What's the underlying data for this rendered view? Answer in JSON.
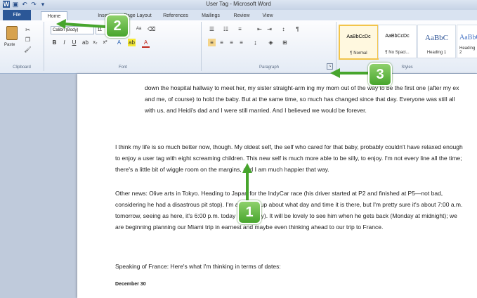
{
  "window": {
    "title": "User Tag - Microsoft Word",
    "qat_icons": [
      "word-icon",
      "save-icon",
      "undo-icon",
      "redo-icon",
      "customize-icon"
    ]
  },
  "tabs": [
    {
      "label": "File"
    },
    {
      "label": "Home"
    },
    {
      "label": "Insert"
    },
    {
      "label": "Page Layout"
    },
    {
      "label": "References"
    },
    {
      "label": "Mailings"
    },
    {
      "label": "Review"
    },
    {
      "label": "View"
    }
  ],
  "ribbon": {
    "clipboard": {
      "paste_label": "Paste",
      "group_label": "Clipboard"
    },
    "font": {
      "font_name": "Calibri (Body)",
      "font_size": "11",
      "group_label": "Font",
      "bold": "B",
      "italic": "I",
      "underline": "U"
    },
    "paragraph": {
      "group_label": "Paragraph"
    },
    "styles": {
      "group_label": "Styles",
      "items": [
        {
          "preview": "AaBbCcDc",
          "name": "¶ Normal"
        },
        {
          "preview": "AaBbCcDc",
          "name": "¶ No Spaci..."
        },
        {
          "preview": "AaBbC",
          "name": "Heading 1"
        },
        {
          "preview": "AaBbC",
          "name": "Heading 2"
        }
      ]
    }
  },
  "document": {
    "paragraphs": [
      "down the hospital hallway to meet her, my sister straight-arm ing my mom out of the way to be the first one (after my ex and me, of course) to hold the baby. But at the same time, so much has changed since that day. Everyone was still all with us, and Heidi's dad and I were still married. And I believed we would be forever.",
      "I think my life is so much better now, though. My oldest self, the self who cared for that baby, probably couldn't have relaxed enough to enjoy a user tag with eight screaming children. This new self is much more able to be silly, to enjoy. I'm not every line all the time; there's a little bit of wiggle room on the margins, and I am much happier that way.",
      "Other news: Olive arts in Tokyo. Heading to Japan for the IndyCar race (his driver started at P2 and finished at P5—not bad, considering he had a disastrous pit stop). I'm all mixed up about what day and time it is there, but I'm pretty sure it's about 7:00 a.m. tomorrow, seeing as here, it's 6:00 p.m. today (obviously). It will be lovely to see him when he gets back (Monday at midnight); we are beginning planning our Miami trip in earnest and maybe even thinking ahead to our trip to France.",
      "Speaking of France: Here's what I'm thinking in terms of dates:",
      "December 30"
    ]
  },
  "callouts": [
    {
      "number": "1"
    },
    {
      "number": "2"
    },
    {
      "number": "3"
    }
  ],
  "colors": {
    "callout_green": "#47a52d",
    "file_tab": "#2b5797",
    "ribbon_bg": "#e4ebf5"
  }
}
